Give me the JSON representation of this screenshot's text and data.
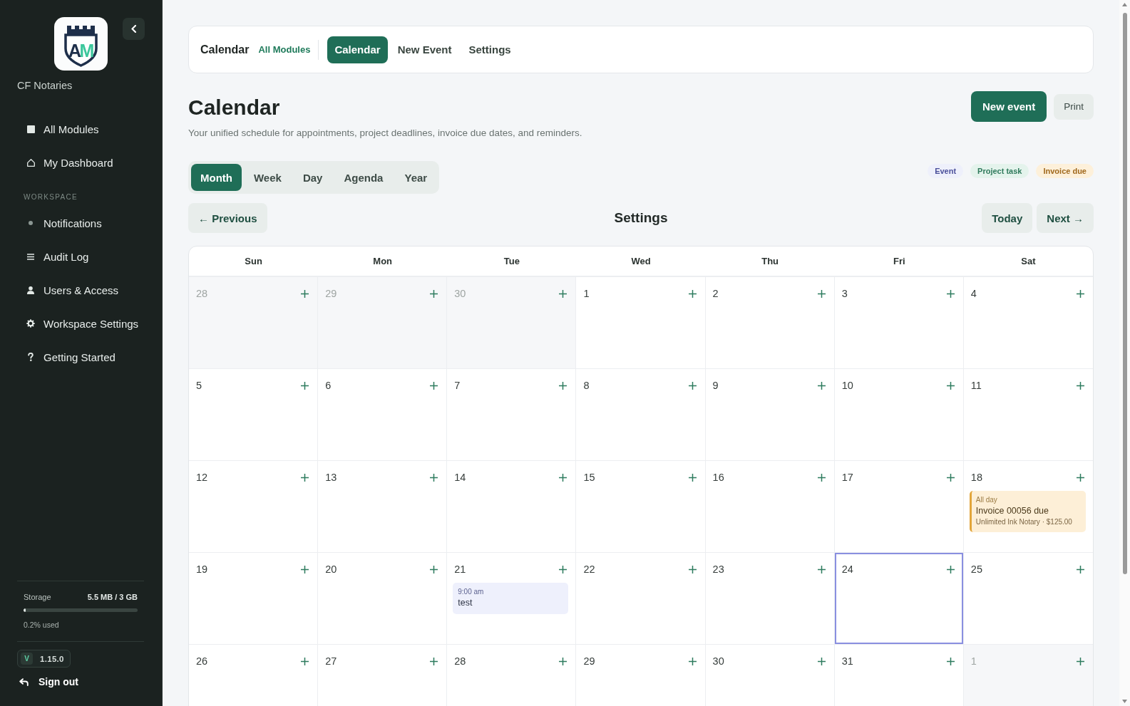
{
  "sidebar": {
    "logo": {
      "monogram": [
        "A",
        "M"
      ]
    },
    "org_name": "CF Notaries",
    "nav": [
      {
        "label": "All Modules",
        "selected": false
      },
      {
        "label": "My Dashboard",
        "selected": false
      }
    ],
    "sections": [
      {
        "title": "WORKSPACE",
        "items": [
          {
            "label": "Notifications",
            "selected": false
          },
          {
            "label": "Audit Log",
            "selected": false
          },
          {
            "label": "Users & Access",
            "selected": false
          },
          {
            "label": "Workspace Settings",
            "selected": false
          },
          {
            "label": "Getting Started",
            "selected": false
          }
        ]
      }
    ],
    "storage": {
      "label": "Storage",
      "value": "5.5 MB / 3 GB",
      "level": 0.002,
      "note": "0.2% used"
    },
    "version": {
      "badge": "V",
      "number": "1.15.0"
    },
    "sign_out": "Sign out"
  },
  "module_bar": {
    "title": "Calendar",
    "link": "All Modules",
    "tabs": [
      {
        "label": "Calendar",
        "selected": true
      },
      {
        "label": "New Event",
        "selected": false
      },
      {
        "label": "Settings",
        "selected": false
      }
    ]
  },
  "page_header": {
    "title": "Calendar",
    "subtitle": "Your unified schedule for appointments, project deadlines, invoice due dates, and reminders.",
    "actions": [
      {
        "label": "New event",
        "kind": "primary"
      },
      {
        "label": "Print",
        "kind": "secondary"
      }
    ]
  },
  "view_tabs": [
    {
      "label": "Month",
      "selected": true
    },
    {
      "label": "Week",
      "selected": false
    },
    {
      "label": "Day",
      "selected": false
    },
    {
      "label": "Agenda",
      "selected": false
    },
    {
      "label": "Year",
      "selected": false
    }
  ],
  "legend": [
    {
      "label": "Event",
      "kind": "event"
    },
    {
      "label": "Project task",
      "kind": "task"
    },
    {
      "label": "Invoice due",
      "kind": "invoice"
    }
  ],
  "period_nav": {
    "previous": "← Previous",
    "title": "Settings",
    "today": "Today",
    "next": "Next →"
  },
  "calendar": {
    "weekdays": [
      "Sun",
      "Mon",
      "Tue",
      "Wed",
      "Thu",
      "Fri",
      "Sat"
    ],
    "weeks": [
      {
        "days": [
          {
            "day": "28",
            "outside_month": true,
            "today": false
          },
          {
            "day": "29",
            "outside_month": true,
            "today": false
          },
          {
            "day": "30",
            "outside_month": true,
            "today": false
          },
          {
            "day": "1",
            "outside_month": false,
            "today": false
          },
          {
            "day": "2",
            "outside_month": false,
            "today": false
          },
          {
            "day": "3",
            "outside_month": false,
            "today": false
          },
          {
            "day": "4",
            "outside_month": false,
            "today": false
          }
        ]
      },
      {
        "days": [
          {
            "day": "5",
            "outside_month": false,
            "today": false
          },
          {
            "day": "6",
            "outside_month": false,
            "today": false
          },
          {
            "day": "7",
            "outside_month": false,
            "today": false
          },
          {
            "day": "8",
            "outside_month": false,
            "today": false
          },
          {
            "day": "9",
            "outside_month": false,
            "today": false
          },
          {
            "day": "10",
            "outside_month": false,
            "today": false
          },
          {
            "day": "11",
            "outside_month": false,
            "today": false
          }
        ]
      },
      {
        "days": [
          {
            "day": "12",
            "outside_month": false,
            "today": false
          },
          {
            "day": "13",
            "outside_month": false,
            "today": false
          },
          {
            "day": "14",
            "outside_month": false,
            "today": false
          },
          {
            "day": "15",
            "outside_month": false,
            "today": false
          },
          {
            "day": "16",
            "outside_month": false,
            "today": false
          },
          {
            "day": "17",
            "outside_month": false,
            "today": false
          },
          {
            "day": "18",
            "outside_month": false,
            "today": false,
            "events": [
              {
                "kind": "invoice",
                "time": "All day",
                "title": "Invoice 00056 due",
                "detail": "Unlimited Ink Notary · $125.00"
              }
            ]
          }
        ]
      },
      {
        "days": [
          {
            "day": "19",
            "outside_month": false,
            "today": false
          },
          {
            "day": "20",
            "outside_month": false,
            "today": false
          },
          {
            "day": "21",
            "outside_month": false,
            "today": false,
            "events": [
              {
                "kind": "event",
                "time": "9:00 am",
                "title": "test"
              }
            ]
          },
          {
            "day": "22",
            "outside_month": false,
            "today": false
          },
          {
            "day": "23",
            "outside_month": false,
            "today": false
          },
          {
            "day": "24",
            "outside_month": false,
            "today": true
          },
          {
            "day": "25",
            "outside_month": false,
            "today": false
          }
        ]
      },
      {
        "days": [
          {
            "day": "26",
            "outside_month": false,
            "today": false
          },
          {
            "day": "27",
            "outside_month": false,
            "today": false
          },
          {
            "day": "28",
            "outside_month": false,
            "today": false
          },
          {
            "day": "29",
            "outside_month": false,
            "today": false
          },
          {
            "day": "30",
            "outside_month": false,
            "today": false
          },
          {
            "day": "31",
            "outside_month": false,
            "today": false
          },
          {
            "day": "1",
            "outside_month": true,
            "today": false
          }
        ]
      }
    ]
  }
}
